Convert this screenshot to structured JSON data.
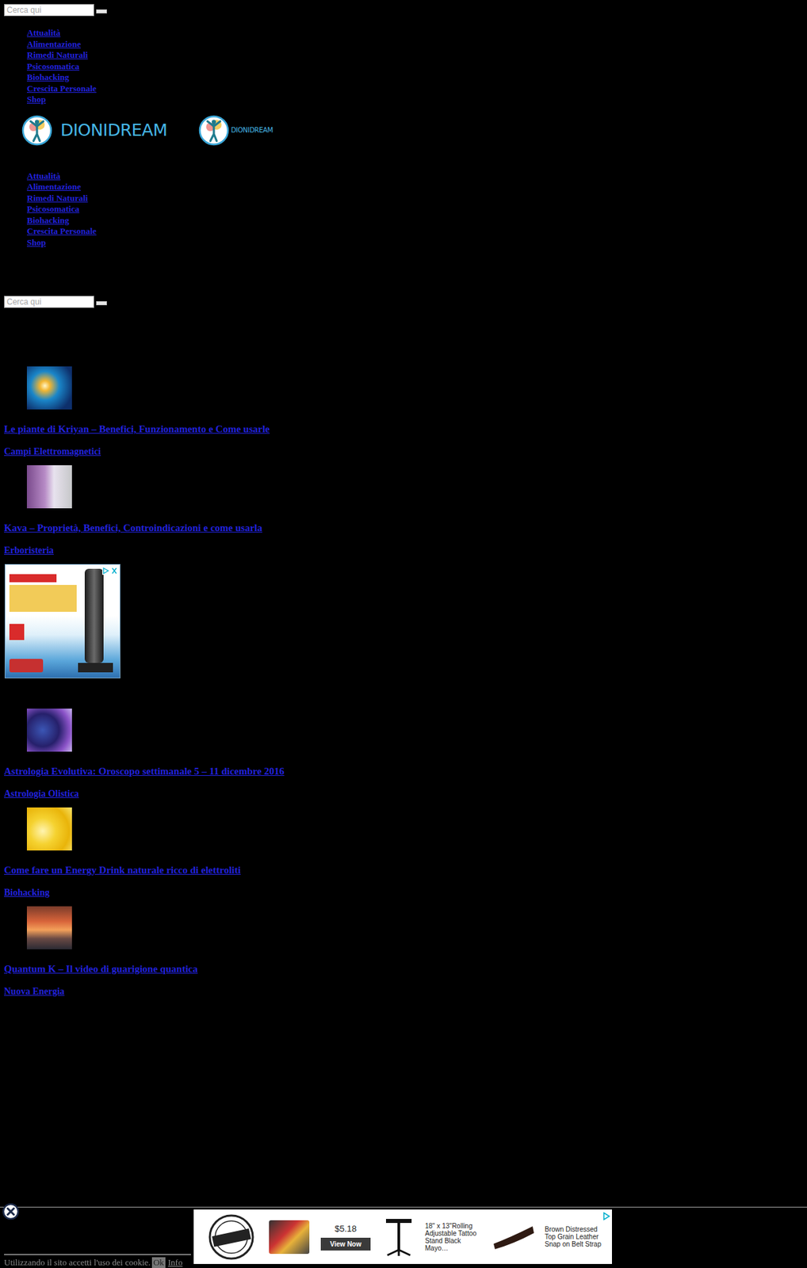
{
  "search_top": {
    "placeholder": "Cerca qui"
  },
  "menu_top": [
    "Attualità",
    "Alimentazione",
    "Rimedi Naturali",
    "Psicosomatica",
    "Biohacking",
    "Crescita Personale",
    "Shop"
  ],
  "logos": [
    {
      "text": "DIONIDREAM"
    },
    {
      "text": "DIONIDREAM"
    }
  ],
  "menu_main": [
    "Attualità",
    "Alimentazione",
    "Rimedi Naturali",
    "Psicosomatica",
    "Biohacking",
    "Crescita Personale",
    "Shop"
  ],
  "search_main": {
    "placeholder": "Cerca qui"
  },
  "articles": [
    {
      "title": "Le piante di Kriyan – Benefici, Funzionamento e Come usarle",
      "category": "Campi Elettromagnetici"
    },
    {
      "title": "Kava – Proprietà, Benefici, Controindicazioni e come usarla",
      "category": "Erboristeria"
    },
    {
      "title": "Astrologia Evolutiva: Oroscopo settimanale 5 – 11 dicembre 2016",
      "category": "Astrologia Olistica"
    },
    {
      "title": "Come fare un Energy Drink naturale ricco di elettroliti",
      "category": "Biohacking"
    },
    {
      "title": "Quantum K – Il video di guarigione quantica",
      "category": "Nuova Energia"
    }
  ],
  "bottom_ad": {
    "price": "$5.18",
    "button": "View Now",
    "captions": [
      "18\" x 13\"Rolling Adjustable Tattoo Stand Black Mayo…",
      "Brown Distressed Top Grain Leather Snap on Belt Strap"
    ]
  },
  "cookie": {
    "text": "Utilizzando il sito accetti l'uso dei cookie.",
    "ok": "Ok",
    "info": "Info"
  }
}
